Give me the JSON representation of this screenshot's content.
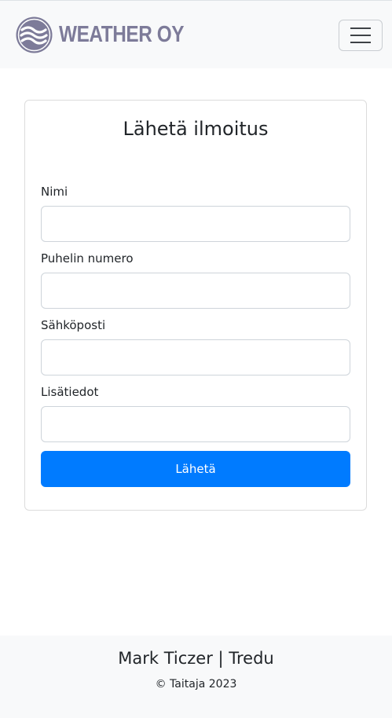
{
  "navbar": {
    "brand": "WEATHER OY",
    "logo_icon": "wave-logo-icon",
    "menu_icon": "hamburger-menu-icon",
    "brand_color": "#7d7b99"
  },
  "form": {
    "title": "Lähetä ilmoitus",
    "fields": [
      {
        "label": "Nimi",
        "value": ""
      },
      {
        "label": "Puhelin numero",
        "value": ""
      },
      {
        "label": "Sähköposti",
        "value": ""
      },
      {
        "label": "Lisätiedot",
        "value": ""
      }
    ],
    "submit_label": "Lähetä",
    "submit_color": "#007bff"
  },
  "footer": {
    "title": "Mark Ticzer | Tredu",
    "copyright": "© Taitaja 2023"
  }
}
